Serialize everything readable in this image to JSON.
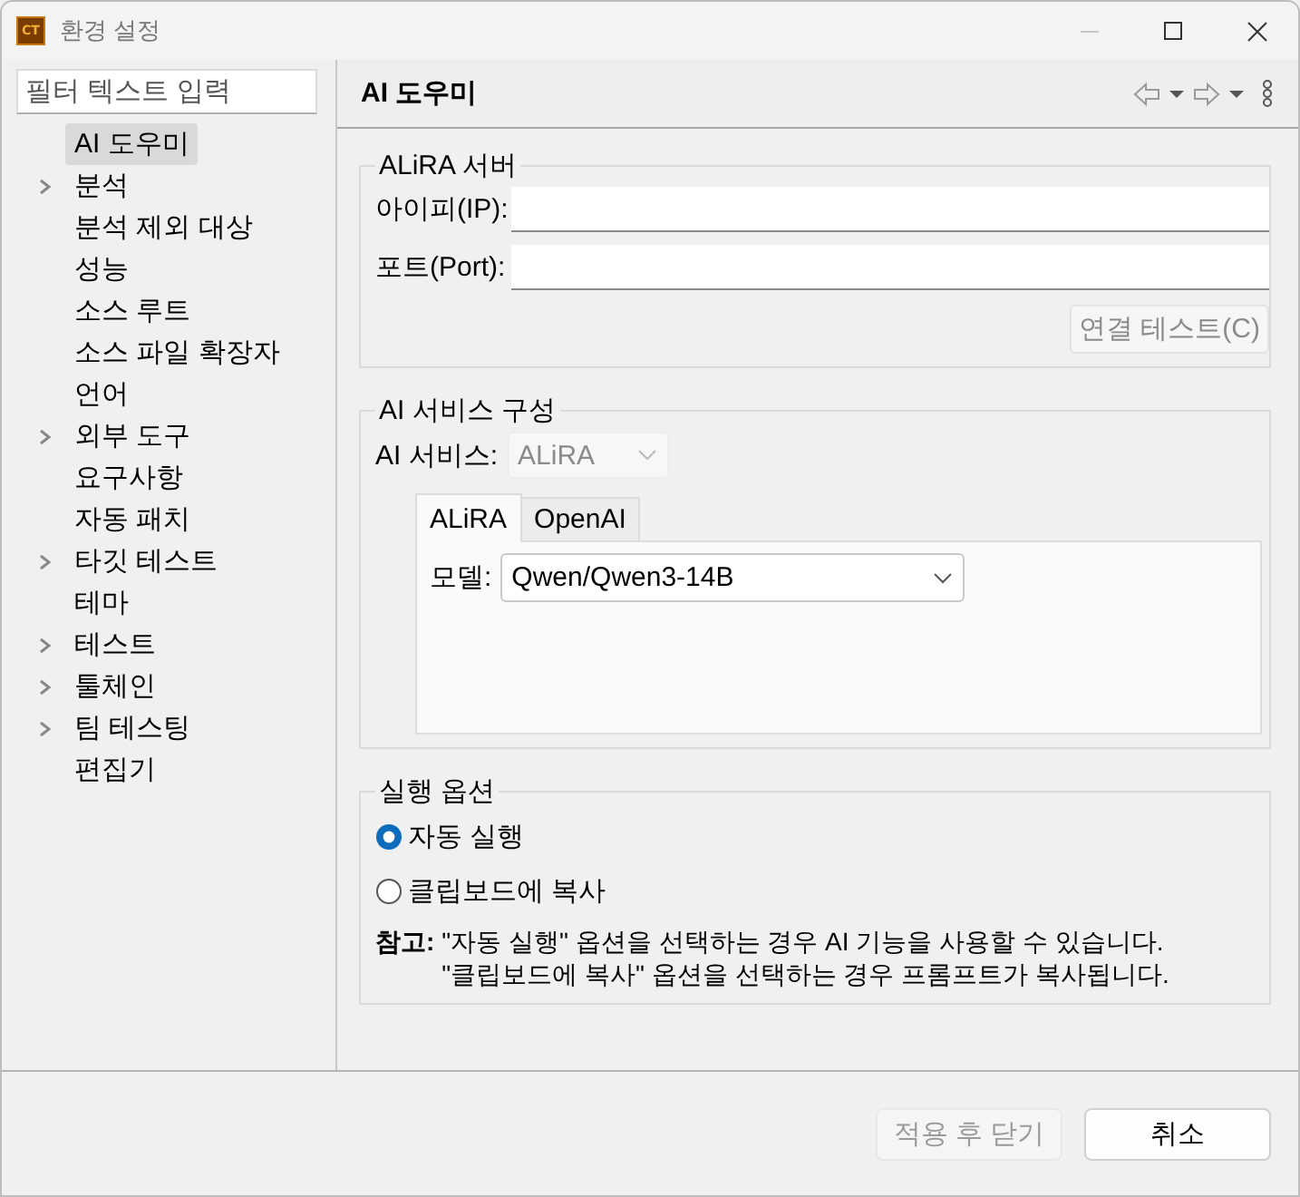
{
  "window": {
    "app_icon_text": "CT",
    "title": "환경 설정"
  },
  "sidebar": {
    "filter": {
      "placeholder": "필터 텍스트 입력"
    },
    "items": [
      {
        "label": "AI 도우미",
        "kind": "page",
        "selected": true
      },
      {
        "label": "분석",
        "kind": "folder",
        "selected": false
      },
      {
        "label": "분석 제외 대상",
        "kind": "page",
        "selected": false
      },
      {
        "label": "성능",
        "kind": "page",
        "selected": false
      },
      {
        "label": "소스 루트",
        "kind": "page",
        "selected": false
      },
      {
        "label": "소스 파일 확장자",
        "kind": "page",
        "selected": false
      },
      {
        "label": "언어",
        "kind": "page",
        "selected": false
      },
      {
        "label": "외부 도구",
        "kind": "folder",
        "selected": false
      },
      {
        "label": "요구사항",
        "kind": "page",
        "selected": false
      },
      {
        "label": "자동 패치",
        "kind": "page",
        "selected": false
      },
      {
        "label": "타깃 테스트",
        "kind": "folder",
        "selected": false
      },
      {
        "label": "테마",
        "kind": "page",
        "selected": false
      },
      {
        "label": "테스트",
        "kind": "folder",
        "selected": false
      },
      {
        "label": "툴체인",
        "kind": "folder",
        "selected": false
      },
      {
        "label": "팀 테스팅",
        "kind": "folder",
        "selected": false
      },
      {
        "label": "편집기",
        "kind": "page",
        "selected": false
      }
    ]
  },
  "page": {
    "title": "AI 도우미",
    "server_group": {
      "title": "ALiRA 서버",
      "fields": [
        {
          "label": "아이피(IP):"
        },
        {
          "label": "포트(Port):"
        }
      ],
      "test_button": {
        "label": "연결 테스트(C)",
        "disabled": true
      }
    },
    "service_group": {
      "title": "AI 서비스 구성",
      "service_select": {
        "label": "AI 서비스:",
        "value": "ALiRA",
        "disabled": true
      },
      "tabs": [
        {
          "label": "ALiRA",
          "selected": true
        },
        {
          "label": "OpenAI",
          "selected": false
        }
      ],
      "model_select": {
        "label": "모델:",
        "value": "Qwen/Qwen3-14B"
      }
    },
    "run_group": {
      "title": "실행 옵션",
      "options": [
        {
          "label": "자동 실행",
          "selected": true
        },
        {
          "label": "클립보드에 복사",
          "selected": false
        }
      ],
      "note": {
        "label": "참고:",
        "lines": [
          "\"자동 실행\" 옵션을 선택하는 경우 AI 기능을 사용할 수 있습니다.",
          "\"클립보드에 복사\" 옵션을 선택하는 경우 프롬프트가 복사됩니다."
        ]
      }
    }
  },
  "footer": {
    "buttons": [
      {
        "label": "적용 후 닫기",
        "disabled": true
      },
      {
        "label": "취소",
        "disabled": false
      }
    ]
  }
}
